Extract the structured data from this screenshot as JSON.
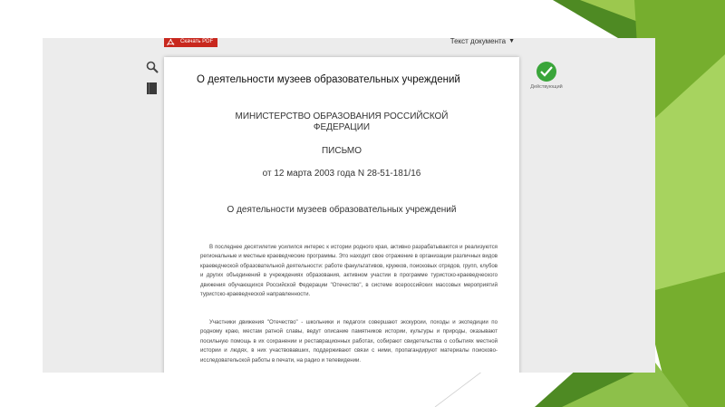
{
  "toolbar": {
    "download_pdf_label": "Скачать PDF",
    "document_text_label": "Текст документа"
  },
  "status": {
    "label": "Действующий",
    "color": "#3aa53a"
  },
  "document": {
    "title": "О деятельности музеев образовательных учреждений",
    "ministry": "МИНИСТЕРСТВО ОБРАЗОВАНИЯ РОССИЙСКОЙ ФЕДЕРАЦИИ",
    "doc_type": "ПИСЬМО",
    "date_number": "от 12 марта 2003 года N 28-51-181/16",
    "subject": "О деятельности музеев образовательных учреждений",
    "paragraphs": [
      "В последнее десятилетие усилился интерес к истории родного края, активно разрабатываются и реализуются региональные и местные краеведческие программы. Это находит свое отражение в организации различных видов краеведческой образовательной деятельности: работе факультативов, кружков, поисковых отрядов, групп, клубов и других объединений в учреждениях образования, активном участии в программе туристско-краеведческого движения обучающихся Российской Федерации \"Отечество\", в системе всероссийских массовых мероприятий туристско-краеведческой направленности.",
      "Участники движения \"Отечество\" - школьники и педагоги совершают экскурсии, походы и экспедиции по родному краю, местам ратной славы, ведут описание памятников истории, культуры и природы, оказывают посильную помощь в их сохранении и реставрационных работах, собирают свидетельства о событиях местной истории и людях, в них участвовавших, поддерживают связи с ними, пропагандируют материалы поисково-исследовательской работы в печати, на радио и телевидении."
    ]
  },
  "colors": {
    "green_dark": "#4e8a23",
    "green_mid": "#76ae2e",
    "green_light": "#9cc84e",
    "pdf_red": "#c8281e",
    "viewer_bg": "#ececec"
  }
}
